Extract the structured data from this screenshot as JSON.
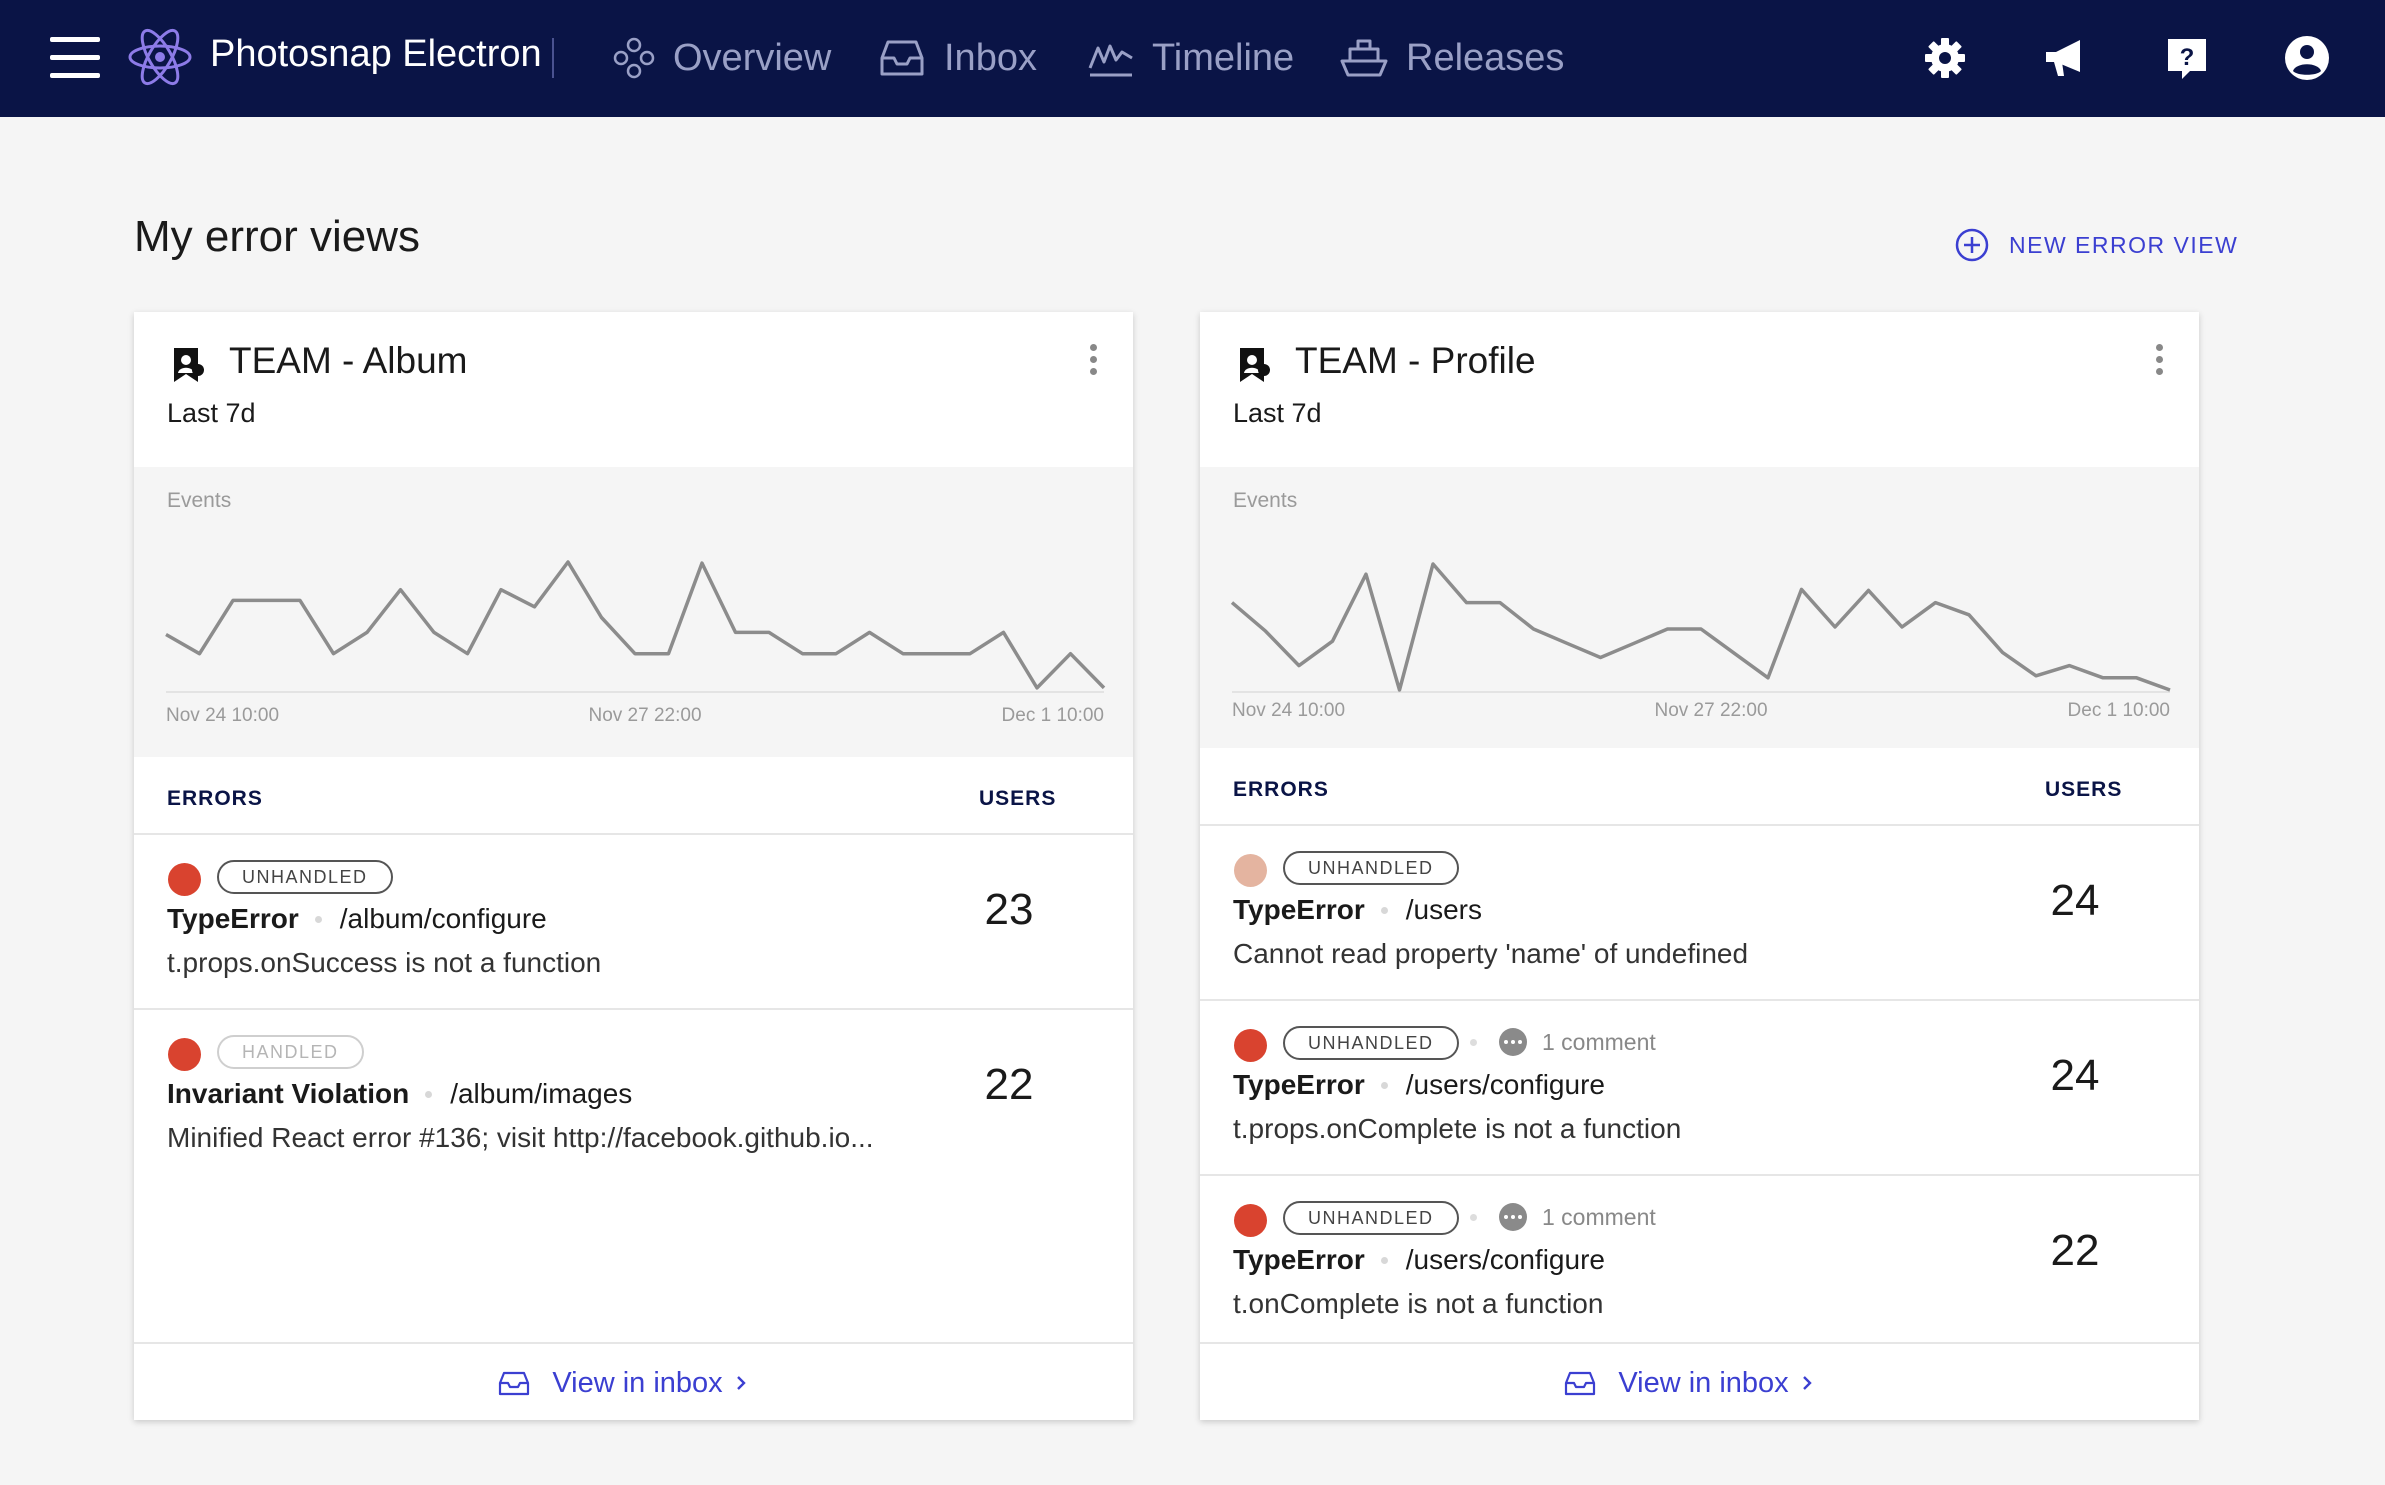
{
  "app": {
    "name": "Photosnap Electron"
  },
  "nav": {
    "items": [
      {
        "label": "Overview",
        "icon": "overview-icon"
      },
      {
        "label": "Inbox",
        "icon": "inbox-icon"
      },
      {
        "label": "Timeline",
        "icon": "timeline-icon"
      },
      {
        "label": "Releases",
        "icon": "releases-icon"
      }
    ],
    "right_icons": [
      "settings-icon",
      "announcement-icon",
      "help-icon",
      "account-icon"
    ]
  },
  "page": {
    "title": "My error views",
    "new_view_label": "NEW ERROR VIEW"
  },
  "colors": {
    "nav_bg": "#0a1446",
    "accent": "#3b3fd1",
    "severity_high": "#d9432f",
    "severity_low": "#e4b4a0"
  },
  "cards": [
    {
      "title": "TEAM - Album",
      "period": "Last 7d",
      "chart_label": "Events",
      "x_ticks": [
        "Nov 24 10:00",
        "Nov 27 22:00",
        "Dec 1 10:00"
      ],
      "series": [
        52,
        34,
        84,
        84,
        84,
        34,
        54,
        94,
        54,
        34,
        94,
        78,
        120,
        68,
        34,
        34,
        119,
        54,
        54,
        34,
        34,
        54,
        34,
        34,
        34,
        54,
        2,
        34,
        2
      ],
      "columns": {
        "errors": "ERRORS",
        "users": "USERS"
      },
      "rows": [
        {
          "severity": "high",
          "badge": "UNHANDLED",
          "handled": false,
          "type": "TypeError",
          "path": "/album/configure",
          "message": "t.props.onSuccess is not a function",
          "users": "23",
          "comment": ""
        },
        {
          "severity": "high",
          "badge": "HANDLED",
          "handled": true,
          "type": "Invariant Violation",
          "path": "/album/images",
          "message": "Minified React error #136; visit http://facebook.github.io...",
          "users": "22",
          "comment": ""
        }
      ],
      "footer": "View in inbox"
    },
    {
      "title": "TEAM - Profile",
      "period": "Last 7d",
      "chart_label": "Events",
      "x_ticks": [
        "Nov 24 10:00",
        "Nov 27 22:00",
        "Dec 1 10:00"
      ],
      "series": [
        86,
        58,
        24,
        48,
        114,
        0,
        124,
        86,
        86,
        60,
        46,
        32,
        46,
        60,
        60,
        36,
        12,
        99,
        62,
        98,
        62,
        86,
        74,
        37,
        14,
        24,
        12,
        12,
        0
      ],
      "columns": {
        "errors": "ERRORS",
        "users": "USERS"
      },
      "rows": [
        {
          "severity": "low",
          "badge": "UNHANDLED",
          "handled": false,
          "type": "TypeError",
          "path": "/users",
          "message": "Cannot read property 'name' of undefined",
          "users": "24",
          "comment": ""
        },
        {
          "severity": "high",
          "badge": "UNHANDLED",
          "handled": false,
          "type": "TypeError",
          "path": "/users/configure",
          "message": "t.props.onComplete is not a function",
          "users": "24",
          "comment": "1 comment"
        },
        {
          "severity": "high",
          "badge": "UNHANDLED",
          "handled": false,
          "type": "TypeError",
          "path": "/users/configure",
          "message": "t.onComplete is not a function",
          "users": "22",
          "comment": "1 comment"
        }
      ],
      "footer": "View in inbox"
    }
  ]
}
